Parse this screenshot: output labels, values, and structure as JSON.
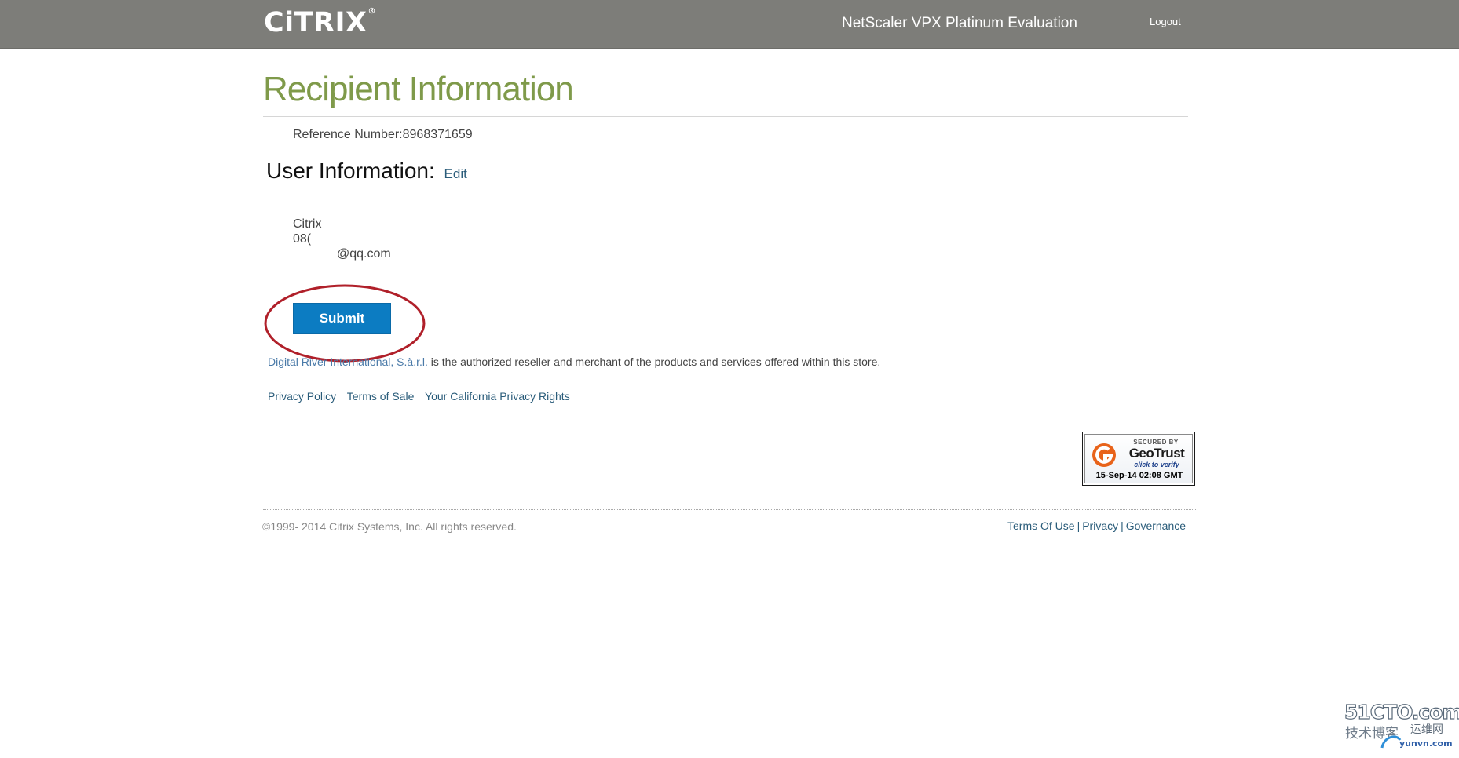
{
  "header": {
    "logo_text": "CiTRIX",
    "logo_mark": "®",
    "product_title": "NetScaler VPX Platinum Evaluation",
    "logout_label": "Logout"
  },
  "page": {
    "title": "Recipient Information",
    "reference_label": "Reference Number:",
    "reference_number": "8968371659"
  },
  "user_info": {
    "heading": "User Information:",
    "edit_label": "Edit",
    "lines": [
      "Citrix",
      "08(",
      "@qq.com"
    ]
  },
  "form": {
    "submit_label": "Submit"
  },
  "reseller": {
    "seller_name": "Digital River International, S.à.r.l.",
    "text": " is the authorized reseller and merchant of the products and services offered within this store."
  },
  "links": {
    "privacy_policy": "Privacy Policy",
    "terms_of_sale": "Terms of Sale",
    "california_rights": "Your California Privacy Rights"
  },
  "badge": {
    "secured_by": "SECURED BY",
    "brand": "GeoTrust",
    "verify": "click to verify",
    "date": "15-Sep-14 02:08 GMT",
    "accent_color": "#e8631a"
  },
  "footer": {
    "copyright": "©1999- 2014 Citrix Systems, Inc. All rights reserved.",
    "terms_of_use": "Terms Of Use",
    "privacy": "Privacy",
    "governance": "Governance",
    "separator": "|"
  },
  "watermark": {
    "brand": "51CTO.com",
    "sub": "技术博客",
    "sub2": "运维网",
    "site": "yunvn.com"
  },
  "colors": {
    "topbar": "#7d7d79",
    "title_green": "#7f9a4a",
    "submit_blue": "#0c7cc2",
    "link_blue": "#2a5c7a",
    "annotation_red": "#b0202a"
  }
}
